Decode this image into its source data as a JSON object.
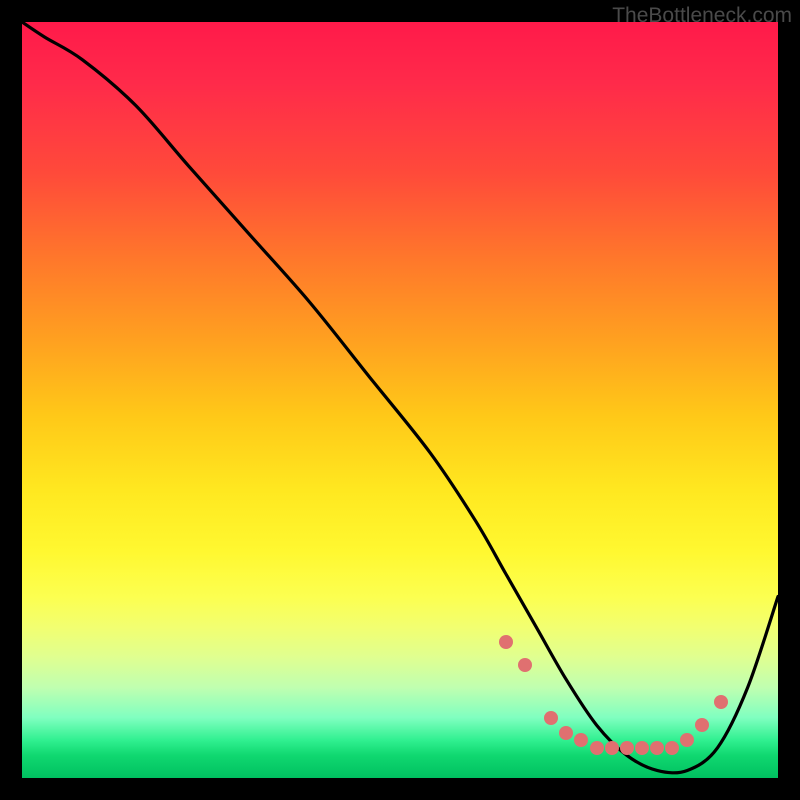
{
  "watermark": "TheBottleneck.com",
  "chart_data": {
    "type": "line",
    "title": "",
    "xlabel": "",
    "ylabel": "",
    "xlim": [
      0,
      100
    ],
    "ylim": [
      0,
      100
    ],
    "curve": {
      "x": [
        0,
        3,
        8,
        15,
        22,
        30,
        38,
        46,
        54,
        60,
        64,
        68,
        72,
        76,
        80,
        84,
        88,
        92,
        96,
        100
      ],
      "y": [
        100,
        98,
        95,
        89,
        81,
        72,
        63,
        53,
        43,
        34,
        27,
        20,
        13,
        7,
        3,
        1,
        1,
        4,
        12,
        24
      ]
    },
    "dot_points": {
      "x": [
        64,
        66.5,
        70,
        72,
        74,
        76,
        78,
        80,
        82,
        84,
        86,
        88,
        90,
        92.5
      ],
      "y": [
        18,
        15,
        8,
        6,
        5,
        4,
        4,
        4,
        4,
        4,
        4,
        5,
        7,
        10
      ]
    },
    "colors": {
      "curve": "#000000",
      "dots": "#e07070"
    }
  }
}
